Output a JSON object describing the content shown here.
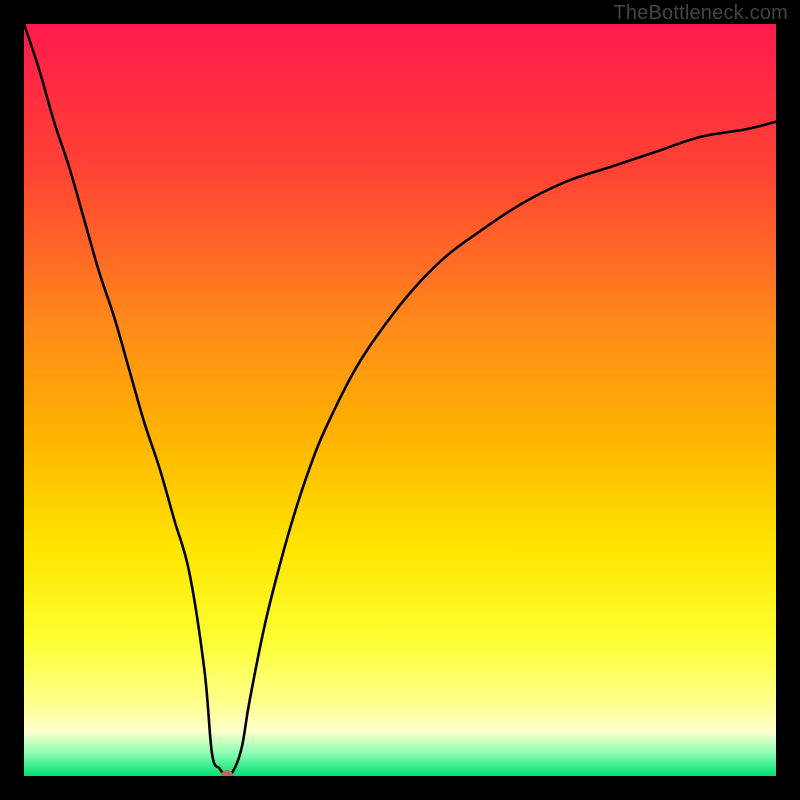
{
  "watermark": "TheBottleneck.com",
  "chart_data": {
    "type": "line",
    "title": "",
    "xlabel": "",
    "ylabel": "",
    "xlim": [
      0,
      100
    ],
    "ylim": [
      0,
      100
    ],
    "grid": false,
    "legend": false,
    "background": {
      "type": "vertical-gradient",
      "stops": [
        {
          "pos": 0.0,
          "color": "#ff1a4d"
        },
        {
          "pos": 0.2,
          "color": "#ff4433"
        },
        {
          "pos": 0.4,
          "color": "#ff8a1a"
        },
        {
          "pos": 0.55,
          "color": "#ffb400"
        },
        {
          "pos": 0.7,
          "color": "#ffe600"
        },
        {
          "pos": 0.82,
          "color": "#fcff33"
        },
        {
          "pos": 0.9,
          "color": "#ffff8a"
        },
        {
          "pos": 0.94,
          "color": "#ffffcc"
        },
        {
          "pos": 0.97,
          "color": "#8affb3"
        },
        {
          "pos": 1.0,
          "color": "#00e070"
        }
      ]
    },
    "series": [
      {
        "name": "bottleneck-curve",
        "color": "#000000",
        "x": [
          0,
          2,
          4,
          6,
          8,
          10,
          12,
          14,
          16,
          18,
          20,
          22,
          24,
          25,
          26,
          27,
          28,
          29,
          30,
          32,
          34,
          36,
          38,
          40,
          44,
          48,
          52,
          56,
          60,
          66,
          72,
          78,
          84,
          90,
          96,
          100
        ],
        "y": [
          100,
          94,
          87,
          81,
          74,
          67,
          61,
          54,
          47,
          41,
          34,
          27,
          14,
          3,
          1,
          0,
          1,
          4,
          10,
          20,
          28,
          35,
          41,
          46,
          54,
          60,
          65,
          69,
          72,
          76,
          79,
          81,
          83,
          85,
          86,
          87
        ]
      }
    ],
    "marker": {
      "x": 27,
      "y": 0,
      "color": "#b86a5d",
      "radius_px": 6
    }
  }
}
